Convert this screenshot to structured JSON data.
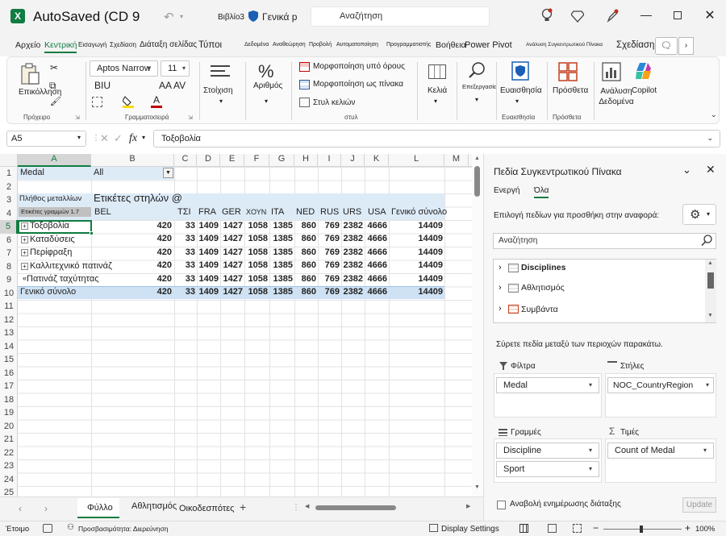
{
  "titlebar": {
    "autosave": "AutoSaved (CD 9",
    "doc_name": "Βιβλίο3",
    "protected_label": "Γενικά p",
    "search_placeholder": "Αναζήτηση"
  },
  "tabs": [
    {
      "label": "Αρχείο"
    },
    {
      "label": "Κεντρική"
    },
    {
      "label": "Εισαγωγή"
    },
    {
      "label": "Σχεδίαση"
    },
    {
      "label": "Διάταξη σελίδας"
    },
    {
      "label": "Τύποι"
    },
    {
      "label": "Δεδομένα"
    },
    {
      "label": "Αναθεώρηση"
    },
    {
      "label": "Προβολή"
    },
    {
      "label": "Αυτοματοποίηση"
    },
    {
      "label": "Προγραμματιστής"
    },
    {
      "label": "Βοήθεια"
    },
    {
      "label": "Power Pivot"
    },
    {
      "label": "Ανάλυση Συγκεντρωτικού Πίνακα"
    },
    {
      "label": "Σχεδίαση"
    }
  ],
  "ribbon": {
    "paste": "Επικόλληση",
    "clipboard_group": "Πρόχειρο",
    "font_name": "Aptos Narrow",
    "font_size": "11",
    "bold_italic_underline": "BIU",
    "grow_shrink": "AA AV",
    "font_group": "Γραμματοσειρά",
    "alignment": "Στοίχιση",
    "number": "Αριθμός",
    "conditional": "Μορφοποίηση υπό όρους",
    "as_table": "Μορφοποίηση ως πίνακα",
    "cell_styles": "Στυλ κελιών",
    "styles_group": "στυλ",
    "cells": "Κελιά",
    "editing": "Επεξεργασία",
    "sensitivity": "Ευαισθησία",
    "sensitivity_group": "Ευαισθησία",
    "addins": "Πρόσθετα",
    "addins_group": "Πρόσθετα",
    "analyze": "Ανάλυση Δεδομένα",
    "copilot": "Copilot"
  },
  "formula_bar": {
    "name_box": "A5",
    "fx": "fx",
    "value": "Τοξοβολία"
  },
  "grid": {
    "columns": [
      "A",
      "B",
      "C",
      "D",
      "E",
      "F",
      "G",
      "H",
      "I",
      "J",
      "K",
      "L",
      "M"
    ],
    "rows": [
      "1",
      "2",
      "3",
      "4",
      "5",
      "6",
      "7",
      "8",
      "9",
      "10",
      "11",
      "12",
      "13",
      "14",
      "15",
      "16",
      "17",
      "18",
      "19",
      "20",
      "21",
      "22",
      "23",
      "24",
      "25"
    ],
    "filter_label": "Medal",
    "filter_value": "All",
    "value_label": "Πλήθος μεταλλίων",
    "col_labels": "Ετικέτες στηλών",
    "row_labels": "Ετικέτες γραμμών",
    "country_headers": [
      "BEL",
      "ΤΣΙ",
      "FRA",
      "GER",
      "ΧΟΥΝ",
      "ITA",
      "NED",
      "RUS",
      "URS",
      "USA",
      "Γενικό σύνολο"
    ],
    "pivot_rows": [
      {
        "label": "Τοξοβολία",
        "values": [
          "420",
          "33",
          "1409",
          "1427",
          "1058",
          "1385",
          "860",
          "769",
          "2382",
          "4666",
          "14409"
        ]
      },
      {
        "label": "Καταδύσεις",
        "values": [
          "420",
          "33",
          "1409",
          "1427",
          "1058",
          "1385",
          "860",
          "769",
          "2382",
          "4666",
          "14409"
        ]
      },
      {
        "label": "Περίφραξη",
        "values": [
          "420",
          "33",
          "1409",
          "1427",
          "1058",
          "1385",
          "860",
          "769",
          "2382",
          "4666",
          "14409"
        ]
      },
      {
        "label": "Καλλιτεχνικό πατινάζ",
        "values": [
          "420",
          "33",
          "1409",
          "1427",
          "1058",
          "1385",
          "860",
          "769",
          "2382",
          "4666",
          "14409"
        ]
      },
      {
        "label": "Πατινάζ ταχύτητας",
        "values": [
          "420",
          "33",
          "1409",
          "1427",
          "1058",
          "1385",
          "860",
          "769",
          "2382",
          "4666",
          "14409"
        ]
      }
    ],
    "grand_total": {
      "label": "Γενικό σύνολο",
      "values": [
        "420",
        "33",
        "1409",
        "1427",
        "1058",
        "1385",
        "860",
        "769",
        "2382",
        "4666",
        "14409"
      ]
    }
  },
  "sheets": [
    {
      "label": "Φύλλο"
    },
    {
      "label": "Αθλητισμός"
    },
    {
      "label": "Οικοδεσπότες"
    }
  ],
  "pane": {
    "title": "Πεδία Συγκεντρωτικού Πίνακα",
    "tab_active": "Ενεργή",
    "tab_all": "Όλα",
    "choose_fields": "Επιλογή πεδίων για προσθήκη στην αναφορά:",
    "search_placeholder": "Αναζήτηση",
    "field_list": [
      {
        "label": "Disciplines"
      },
      {
        "label": "Αθλητισμός"
      },
      {
        "label": "Συμβάντα"
      }
    ],
    "drag_hint": "Σύρετε πεδία μεταξύ των περιοχών παρακάτω.",
    "filters_label": "Φίλτρα",
    "columns_label": "Στήλες",
    "rows_label": "Γραμμές",
    "values_label": "Τιμές",
    "filters_field": "Medal",
    "columns_field": "NOC_CountryRegion",
    "rows_fields": [
      "Discipline",
      "Sport"
    ],
    "values_field": "Count of Medal",
    "defer": "Αναβολή ενημέρωσης διάταξης",
    "update": "Update"
  },
  "statusbar": {
    "ready": "Έτοιμο",
    "accessibility": "Προσβασιμότητα: Διερεύνηση",
    "display_settings": "Display Settings",
    "zoom": "100%"
  },
  "colors": {
    "accent": "#107c41",
    "pivot_header": "#ddebf7",
    "pivot_fill": "#cfe2f3"
  }
}
